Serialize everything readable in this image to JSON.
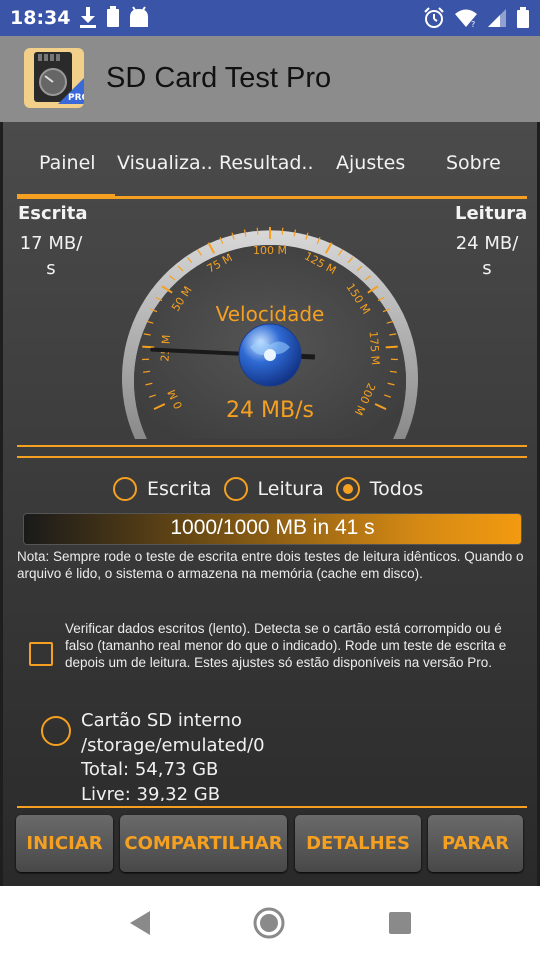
{
  "status_bar": {
    "time": "18:34",
    "icons_left": [
      "download-icon",
      "battery-saver-icon",
      "android-icon"
    ],
    "icons_right": [
      "alarm-icon",
      "wifi-icon",
      "signal-icon",
      "battery-icon"
    ]
  },
  "app": {
    "title": "SD Card Test Pro",
    "icon_badge": "PRO"
  },
  "tabs": [
    {
      "label": "Painel",
      "active": true
    },
    {
      "label": "Visualiza.."
    },
    {
      "label": "Resultad.."
    },
    {
      "label": "Ajustes"
    },
    {
      "label": "Sobre"
    }
  ],
  "write": {
    "title": "Escrita",
    "value_line1": "17 MB/",
    "value_line2": "s"
  },
  "read": {
    "title": "Leitura",
    "value_line1": "24 MB/",
    "value_line2": "s"
  },
  "gauge": {
    "title": "Velocidade",
    "value_text": "24 MB/s",
    "value": 24,
    "max": 200,
    "ticks": [
      "0 M",
      "25 M",
      "50 M",
      "75 M",
      "100 M",
      "125 M",
      "150 M",
      "175 M",
      "200 M"
    ]
  },
  "mode_options": [
    {
      "label": "Escrita",
      "checked": false
    },
    {
      "label": "Leitura",
      "checked": false
    },
    {
      "label": "Todos",
      "checked": true
    }
  ],
  "progress": {
    "text": "1000/1000 MB in 41 s",
    "fraction": 1.0
  },
  "note": "Nota: Sempre rode o teste de escrita entre dois testes de leitura idênticos. Quando o arquivo é lido, o sistema o armazena na memória (cache em disco).",
  "verify": {
    "checked": false,
    "text": "Verificar dados escritos (lento). Detecta se o cartão está corrompido ou é falso (tamanho real menor do que o indicado). Rode um teste de escrita e depois um de leitura. Estes ajustes só estão disponíveis na versão Pro."
  },
  "storage": {
    "name": "Cartão SD interno",
    "path": "/storage/emulated/0",
    "total": "Total: 54,73 GB",
    "free": "Livre: 39,32 GB"
  },
  "buttons": {
    "start": "INICIAR",
    "share": "COMPARTILHAR",
    "details": "DETALHES",
    "stop": "PARAR"
  },
  "colors": {
    "accent": "#f5a020",
    "status_bar": "#3a54a8",
    "app_bar": "#8c8c8c",
    "panel": "#3a3a3a"
  },
  "nav": [
    "back-icon",
    "home-icon",
    "recents-icon"
  ]
}
